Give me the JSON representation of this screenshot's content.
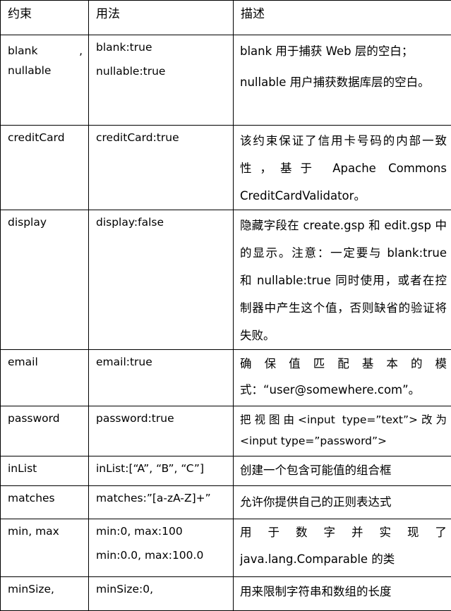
{
  "headers": {
    "constraint": "约束",
    "usage": "用法",
    "description": "描述"
  },
  "rows": [
    {
      "constraint_lines": [
        "blank",
        ",",
        "nullable"
      ],
      "usage_lines": [
        "blank:true",
        "nullable:true"
      ],
      "description_lines": [
        "blank 用于捕获 Web 层的空白；",
        "nullable 用户捕获数据库层的空白。"
      ]
    },
    {
      "constraint_lines": [
        "creditCard"
      ],
      "usage_lines": [
        "creditCard:true"
      ],
      "description_lines": [
        "该约束保证了信用卡号码的内部一致性，基于 Apache Commons CreditCardValidator。"
      ]
    },
    {
      "constraint_lines": [
        "display"
      ],
      "usage_lines": [
        "display:false"
      ],
      "description_lines": [
        "隐藏字段在 create.gsp 和 edit.gsp 中的显示。注意：一定要与 blank:true 和 nullable:true 同时使用，或者在控制器中产生这个值，否则缺省的验证将失败。"
      ]
    },
    {
      "constraint_lines": [
        "email"
      ],
      "usage_lines": [
        "email:true"
      ],
      "description_lines": [
        "确保值匹配基本的模式：“user@somewhere.com”。"
      ]
    },
    {
      "constraint_lines": [
        "password"
      ],
      "usage_lines": [
        "password:true"
      ],
      "description_lines": [
        "把视图由<input type=”text”>改为<input type=”password”>"
      ]
    },
    {
      "constraint_lines": [
        "inList"
      ],
      "usage_lines": [
        "inList:[“A”, “B”, “C”]"
      ],
      "description_lines": [
        "创建一个包含可能值的组合框"
      ]
    },
    {
      "constraint_lines": [
        "matches"
      ],
      "usage_lines": [
        "matches:”[a-zA-Z]+”"
      ],
      "description_lines": [
        "允许你提供自己的正则表达式"
      ]
    },
    {
      "constraint_lines": [
        "min, max"
      ],
      "usage_lines": [
        "min:0, max:100",
        "min:0.0, max:100.0"
      ],
      "description_lines": [
        "用于数字并实现了 java.lang.Comparable 的类"
      ]
    },
    {
      "constraint_lines": [
        "minSize,"
      ],
      "usage_lines": [
        "minSize:0,"
      ],
      "description_lines": [
        "用来限制字符串和数组的长度"
      ]
    }
  ]
}
